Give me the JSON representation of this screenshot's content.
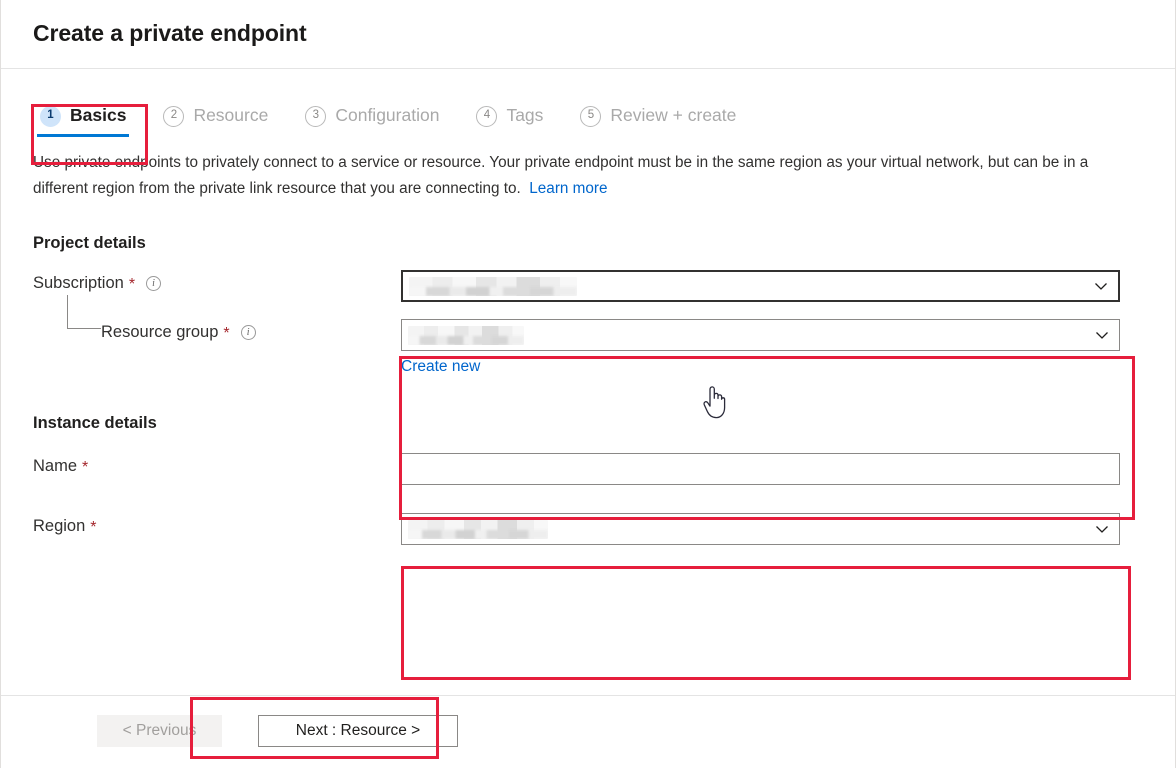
{
  "header": {
    "title": "Create a private endpoint"
  },
  "tabs": [
    {
      "num": "1",
      "label": "Basics",
      "active": true
    },
    {
      "num": "2",
      "label": "Resource",
      "active": false
    },
    {
      "num": "3",
      "label": "Configuration",
      "active": false
    },
    {
      "num": "4",
      "label": "Tags",
      "active": false
    },
    {
      "num": "5",
      "label": "Review + create",
      "active": false
    }
  ],
  "description": {
    "text": "Use private endpoints to privately connect to a service or resource. Your private endpoint must be in the same region as your virtual network, but can be in a different region from the private link resource that you are connecting to.",
    "learn_more": "Learn more"
  },
  "project_details": {
    "section_title": "Project details",
    "subscription": {
      "label": "Subscription",
      "required_marker": "*",
      "info_glyph": "i",
      "value": "",
      "redacted": true
    },
    "resource_group": {
      "label": "Resource group",
      "required_marker": "*",
      "info_glyph": "i",
      "value": "",
      "redacted": true,
      "create_new_label": "Create new"
    }
  },
  "instance_details": {
    "section_title": "Instance details",
    "name": {
      "label": "Name",
      "required_marker": "*",
      "value": "",
      "placeholder": ""
    },
    "region": {
      "label": "Region",
      "required_marker": "*",
      "value": "",
      "redacted": true
    }
  },
  "footer": {
    "previous_label": "< Previous",
    "next_label": "Next : Resource >"
  },
  "colors": {
    "annotation_red": "#e61e3c",
    "accent_blue": "#0078d4",
    "link_blue": "#0066cc",
    "required_red": "#a4262c",
    "active_tab_badge_bg": "#cfe4fa"
  },
  "cursor": {
    "icon": "pointing-hand-cursor"
  }
}
